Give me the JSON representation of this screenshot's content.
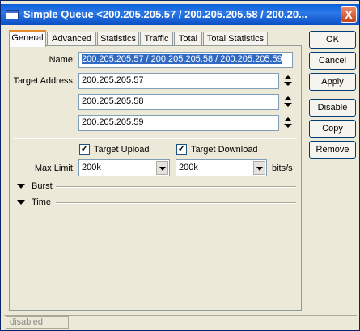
{
  "window": {
    "title": "Simple Queue <200.205.205.57 / 200.205.205.58 / 200.20...",
    "close_glyph": "X"
  },
  "tabs": [
    "General",
    "Advanced",
    "Statistics",
    "Traffic",
    "Total",
    "Total Statistics"
  ],
  "form": {
    "name_label": "Name:",
    "name_value": "200.205.205.57 / 200.205.205.58 / 200.205.205.59",
    "target_label": "Target Address:",
    "targets": [
      "200.205.205.57",
      "200.205.205.58",
      "200.205.205.59"
    ],
    "target_upload_label": "Target Upload",
    "target_upload_checked": true,
    "target_download_label": "Target Download",
    "target_download_checked": true,
    "check_glyph": "✓",
    "max_limit_label": "Max Limit:",
    "max_limit_upload": "200k",
    "max_limit_download": "200k",
    "unit": "bits/s",
    "burst_label": "Burst",
    "time_label": "Time"
  },
  "buttons": [
    "OK",
    "Cancel",
    "Apply",
    "Disable",
    "Copy",
    "Remove"
  ],
  "status": {
    "text": "disabled"
  },
  "colors": {
    "titlebar": "#0a5fd8",
    "selection": "#316ac5",
    "tab_accent": "#e68b2c"
  }
}
